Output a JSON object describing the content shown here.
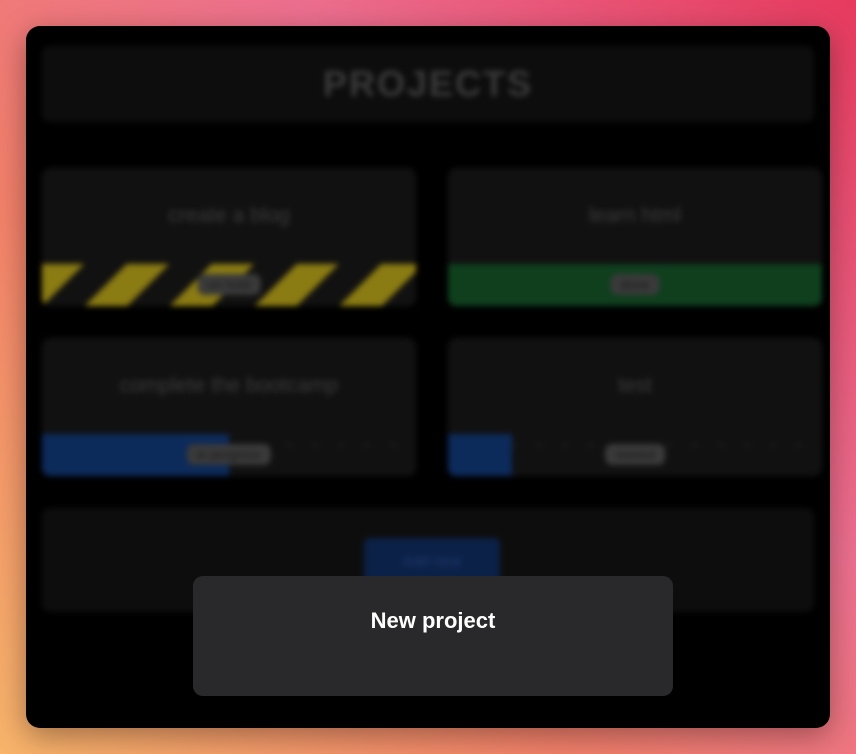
{
  "header": {
    "title": "PROJECTS"
  },
  "projects": [
    {
      "name": "create a blog",
      "status": "on hold",
      "progress": 1.0,
      "style": "stripes"
    },
    {
      "name": "learn html",
      "status": "done",
      "progress": 1.0,
      "color": "#0f3f1d"
    },
    {
      "name": "complete the bootcamp",
      "status": "in progress",
      "progress": 0.5,
      "color": "#0c2a5a"
    },
    {
      "name": "test",
      "status": "started",
      "progress": 0.17,
      "color": "#0c2a5a"
    }
  ],
  "add": {
    "label": "Add new"
  },
  "modal": {
    "title": "New project"
  }
}
